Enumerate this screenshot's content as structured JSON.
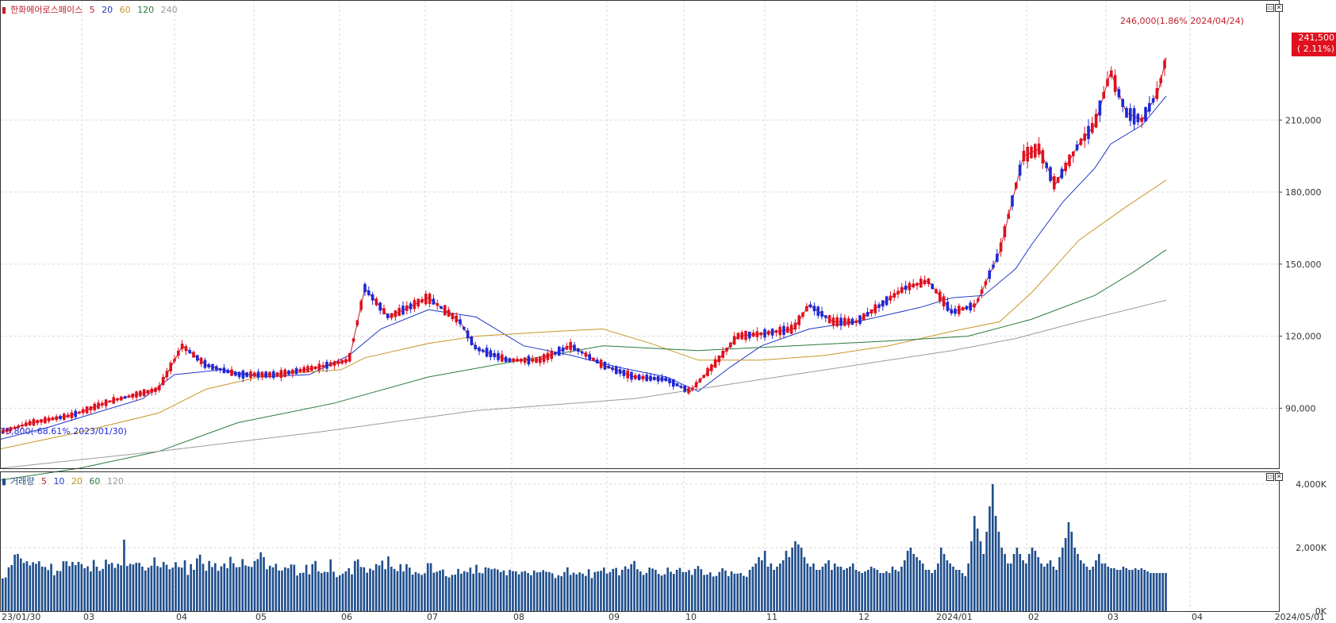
{
  "price_panel": {
    "legend": {
      "name": "한화에어로스페이스",
      "items": [
        {
          "label": "5",
          "color": "#c0202c"
        },
        {
          "label": "20",
          "color": "#2038c8"
        },
        {
          "label": "60",
          "color": "#c89628"
        },
        {
          "label": "120",
          "color": "#2a7a3c"
        },
        {
          "label": "240",
          "color": "#9a9a9a"
        }
      ]
    },
    "high_annotation": "246,000(1.86% 2024/04/24)",
    "low_annotation": "75,800(-68.61% 2023/01/30)",
    "current_price": "241,500",
    "current_change": "( 2.11%)",
    "y_ticks": [
      "90,000",
      "120,000",
      "150,000",
      "180,000",
      "210,000"
    ]
  },
  "volume_panel": {
    "legend": {
      "name": "거래량",
      "items": [
        {
          "label": "5",
          "color": "#c0202c"
        },
        {
          "label": "10",
          "color": "#2038c8"
        },
        {
          "label": "20",
          "color": "#c89628"
        },
        {
          "label": "60",
          "color": "#2a7a3c"
        },
        {
          "label": "120",
          "color": "#9a9a9a"
        }
      ]
    },
    "y_ticks": [
      "0K",
      "2,000K",
      "4,000K"
    ]
  },
  "x_labels": [
    "23/01/30",
    "03",
    "04",
    "05",
    "06",
    "07",
    "08",
    "09",
    "10",
    "11",
    "12",
    "2024/01",
    "02",
    "03",
    "04",
    "2024/05/01"
  ],
  "colors": {
    "up": "#e0101e",
    "down": "#1e28d8",
    "volume": "#1f4e8c",
    "grid": "#d8d8d8"
  },
  "chart_data": [
    {
      "type": "candlestick",
      "title": "한화에어로스페이스",
      "x_range": [
        "2023/01/30",
        "2024/04/26"
      ],
      "ylim": [
        65000,
        260000
      ],
      "series": [
        {
          "name": "5",
          "values": [
            [
              0,
              80000
            ],
            [
              40,
              84000
            ],
            [
              90,
              87000
            ],
            [
              140,
              93000
            ],
            [
              200,
              98000
            ],
            [
              230,
              116000
            ],
            [
              260,
              108000
            ],
            [
              300,
              104000
            ],
            [
              350,
              104000
            ],
            [
              400,
              107000
            ],
            [
              440,
              110000
            ],
            [
              460,
              140000
            ],
            [
              490,
              128000
            ],
            [
              540,
              136000
            ],
            [
              580,
              126000
            ],
            [
              600,
              115000
            ],
            [
              640,
              110000
            ],
            [
              680,
              110000
            ],
            [
              720,
              116000
            ],
            [
              760,
              108000
            ],
            [
              800,
              103000
            ],
            [
              840,
              102000
            ],
            [
              870,
              97000
            ],
            [
              900,
              108000
            ],
            [
              930,
              120000
            ],
            [
              960,
              121000
            ],
            [
              1000,
              123000
            ],
            [
              1020,
              133000
            ],
            [
              1050,
              126000
            ],
            [
              1080,
              126000
            ],
            [
              1110,
              133000
            ],
            [
              1140,
              140000
            ],
            [
              1170,
              143000
            ],
            [
              1200,
              130000
            ],
            [
              1230,
              133000
            ],
            [
              1260,
              155000
            ],
            [
              1290,
              195000
            ],
            [
              1310,
              198000
            ],
            [
              1330,
              183000
            ],
            [
              1360,
              200000
            ],
            [
              1380,
              208000
            ],
            [
              1400,
              230000
            ],
            [
              1420,
              213000
            ],
            [
              1440,
              210000
            ],
            [
              1460,
              222000
            ],
            [
              1470,
              236000
            ]
          ]
        },
        {
          "name": "20",
          "values": [
            [
              0,
              77000
            ],
            [
              60,
              82000
            ],
            [
              120,
              88000
            ],
            [
              180,
              94000
            ],
            [
              220,
              104000
            ],
            [
              280,
              106000
            ],
            [
              330,
              103000
            ],
            [
              390,
              104000
            ],
            [
              440,
              112000
            ],
            [
              480,
              123000
            ],
            [
              540,
              131000
            ],
            [
              600,
              128000
            ],
            [
              660,
              116000
            ],
            [
              720,
              112000
            ],
            [
              780,
              107000
            ],
            [
              840,
              103000
            ],
            [
              880,
              97000
            ],
            [
              920,
              107000
            ],
            [
              960,
              116000
            ],
            [
              1020,
              123000
            ],
            [
              1080,
              126000
            ],
            [
              1120,
              129000
            ],
            [
              1160,
              132000
            ],
            [
              1200,
              136000
            ],
            [
              1240,
              137000
            ],
            [
              1280,
              148000
            ],
            [
              1300,
              158000
            ],
            [
              1340,
              176000
            ],
            [
              1380,
              190000
            ],
            [
              1400,
              200000
            ],
            [
              1440,
              208000
            ],
            [
              1470,
              220000
            ]
          ]
        },
        {
          "name": "60",
          "values": [
            [
              0,
              73000
            ],
            [
              100,
              80000
            ],
            [
              200,
              88000
            ],
            [
              260,
              98000
            ],
            [
              340,
              104000
            ],
            [
              430,
              106000
            ],
            [
              460,
              111000
            ],
            [
              540,
              117000
            ],
            [
              600,
              120000
            ],
            [
              700,
              122000
            ],
            [
              760,
              123000
            ],
            [
              820,
              117000
            ],
            [
              880,
              110000
            ],
            [
              960,
              110000
            ],
            [
              1040,
              112000
            ],
            [
              1120,
              116000
            ],
            [
              1200,
              122000
            ],
            [
              1260,
              126000
            ],
            [
              1300,
              138000
            ],
            [
              1360,
              160000
            ],
            [
              1420,
              174000
            ],
            [
              1470,
              185000
            ]
          ]
        },
        {
          "name": "120",
          "values": [
            [
              0,
              60000
            ],
            [
              100,
              65000
            ],
            [
              200,
              72000
            ],
            [
              300,
              84000
            ],
            [
              420,
              92000
            ],
            [
              540,
              103000
            ],
            [
              640,
              109000
            ],
            [
              760,
              116000
            ],
            [
              880,
              114000
            ],
            [
              1000,
              116000
            ],
            [
              1120,
              118000
            ],
            [
              1220,
              120000
            ],
            [
              1300,
              127000
            ],
            [
              1380,
              137000
            ],
            [
              1430,
              147000
            ],
            [
              1470,
              156000
            ]
          ]
        },
        {
          "name": "240",
          "values": [
            [
              0,
              65000
            ],
            [
              200,
              72000
            ],
            [
              400,
              80000
            ],
            [
              600,
              89000
            ],
            [
              800,
              94000
            ],
            [
              900,
              99000
            ],
            [
              1000,
              104000
            ],
            [
              1100,
              109000
            ],
            [
              1200,
              114000
            ],
            [
              1280,
              119000
            ],
            [
              1360,
              126000
            ],
            [
              1470,
              135000
            ]
          ]
        }
      ]
    },
    {
      "type": "bar",
      "title": "거래량",
      "ylim": [
        0,
        4400
      ],
      "ylabel": "K",
      "values": [
        1030,
        1060,
        1380,
        1450,
        1780,
        1800,
        1660,
        1520,
        1570,
        1440,
        1540,
        1490,
        1570,
        1400,
        1390,
        1290,
        1490,
        1130,
        1270,
        1260,
        1570,
        1570,
        1420,
        1550,
        1450,
        1550,
        1480,
        1350,
        1410,
        1250,
        1610,
        1400,
        1270,
        1330,
        1620,
        1480,
        1520,
        1360,
        1490,
        1440,
        2250,
        1420,
        1490,
        1470,
        1520,
        1520,
        1400,
        1280,
        1370,
        1430,
        1690,
        1420,
        1380,
        1550,
        1460,
        1320,
        1370,
        1540,
        1390,
        1370,
        1600,
        1140,
        1480,
        1300,
        1660,
        1780,
        1490,
        1270,
        1580,
        1390,
        1510,
        1270,
        1410,
        1500,
        1350,
        1710,
        1510,
        1380,
        1390,
        1640,
        1440,
        1410,
        1390,
        1580,
        1640,
        1850,
        1700,
        1320,
        1430,
        1380,
        1490,
        1280,
        1280,
        1380,
        1350,
        1470,
        1460,
        1120,
        1200,
        1210,
        1460,
        1160,
        1480,
        1580,
        1250,
        1200,
        1240,
        1230,
        1630,
        1240,
        1070,
        1130,
        1180,
        1250,
        1350,
        1160,
        1580,
        1630,
        1390,
        1380,
        1210,
        1340,
        1290,
        1480,
        1440,
        1590,
        1320,
        1720,
        1400,
        1330,
        1260,
        1480,
        1250,
        1480,
        1370,
        1150,
        1230,
        1190,
        1140,
        1190,
        1510,
        1510,
        1210,
        1240,
        1280,
        1310,
        1100,
        1060,
        1140,
        1150,
        1330,
        1180,
        1260,
        1230,
        1370,
        1180,
        1460,
        1210,
        1190,
        1380,
        1360,
        1320,
        1340,
        1310,
        1230,
        1280,
        1130,
        1300,
        1260,
        1250,
        1160,
        1240,
        1260,
        1200,
        1130,
        1280,
        1220,
        1230,
        1290,
        1240,
        1230,
        1190,
        1040,
        1130,
        1100,
        1230,
        1380,
        1140,
        1210,
        1160,
        1220,
        1180,
        1110,
        1320,
        1040,
        1230,
        1250,
        1270,
        1370,
        1180,
        1230,
        1330,
        1360,
        1130,
        1300,
        1410,
        1330,
        1480,
        1580,
        1320,
        1250,
        1140,
        1200,
        1370,
        1340,
        1300,
        1170,
        1120,
        1160,
        1370,
        1240,
        1170,
        1300,
        1360,
        1230,
        1230,
        1290,
        1140,
        1330,
        1420,
        1320,
        1140,
        1150,
        1220,
        1090,
        1110,
        1230,
        1350,
        1280,
        1100,
        1250,
        1180,
        1180,
        1200,
        1110,
        1080,
        1300,
        1400,
        1500,
        1700,
        1600,
        1900,
        1400,
        1500,
        1300,
        1400,
        1500,
        1600,
        1900,
        1700,
        2000,
        2200,
        2100,
        2000,
        1700,
        1500,
        1400,
        1500,
        1300,
        1300,
        1400,
        1500,
        1600,
        1300,
        1500,
        1400,
        1400,
        1300,
        1350,
        1400,
        1500,
        1300,
        1250,
        1200,
        1250,
        1300,
        1400,
        1350,
        1300,
        1200,
        1200,
        1250,
        1200,
        1400,
        1300,
        1250,
        1400,
        1600,
        1900,
        2000,
        1800,
        1700,
        1600,
        1500,
        1300,
        1300,
        1200,
        1300,
        1500,
        2000,
        1800,
        1600,
        1500,
        1400,
        1300,
        1300,
        1200,
        1100,
        1500,
        2200,
        3000,
        2600,
        2200,
        1800,
        2500,
        3300,
        4000,
        3000,
        2500,
        2000,
        1800,
        1500,
        1500,
        1800,
        2000,
        1800,
        1600,
        1500,
        1800,
        2000,
        1900,
        1700,
        1500,
        1400,
        1500,
        1600,
        1400,
        1300,
        1700,
        2000,
        2300,
        2800,
        2500,
        2000,
        1800,
        1600,
        1500,
        1400,
        1300,
        1400,
        1600,
        1800,
        1500,
        1500,
        1400,
        1350,
        1350,
        1300,
        1300,
        1400,
        1350,
        1300,
        1300,
        1350,
        1300,
        1350,
        1300,
        1250,
        1200,
        1200,
        1200,
        1200,
        1200,
        1200
      ]
    }
  ]
}
